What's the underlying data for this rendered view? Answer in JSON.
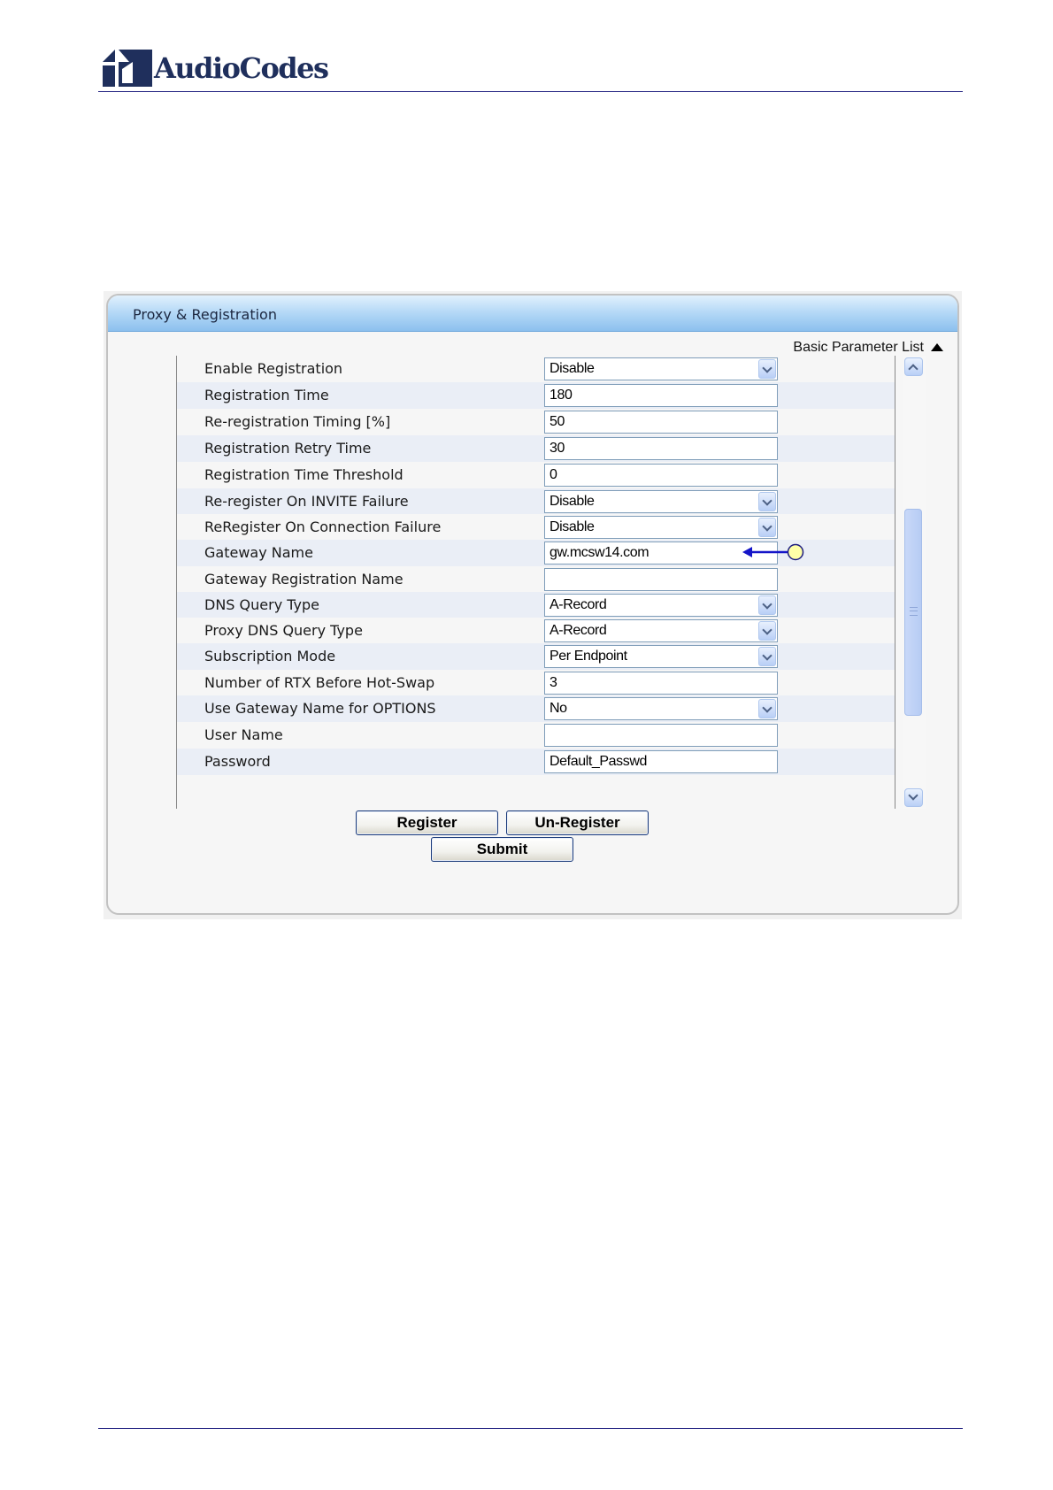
{
  "document": {
    "brand": "AudioCodes"
  },
  "window": {
    "title": "Proxy & Registration"
  },
  "toolbar": {
    "parameter_list_label": "Basic Parameter List"
  },
  "form": {
    "rows": [
      {
        "label": "Enable Registration",
        "type": "select",
        "value": "Disable"
      },
      {
        "label": "Registration Time",
        "type": "input",
        "value": "180"
      },
      {
        "label": "Re-registration Timing [%]",
        "type": "input",
        "value": "50"
      },
      {
        "label": "Registration Retry Time",
        "type": "input",
        "value": "30"
      },
      {
        "label": "Registration Time Threshold",
        "type": "input",
        "value": "0"
      },
      {
        "label": "Re-register On INVITE Failure",
        "type": "select",
        "value": "Disable"
      },
      {
        "label": "ReRegister On Connection Failure",
        "type": "select",
        "value": "Disable"
      },
      {
        "label": "Gateway Name",
        "type": "input",
        "value": "gw.mcsw14.com"
      },
      {
        "label": "Gateway Registration Name",
        "type": "input",
        "value": ""
      },
      {
        "label": "DNS Query Type",
        "type": "select",
        "value": "A-Record"
      },
      {
        "label": "Proxy DNS Query Type",
        "type": "select",
        "value": "A-Record"
      },
      {
        "label": "Subscription Mode",
        "type": "select",
        "value": "Per Endpoint"
      },
      {
        "label": "Number of RTX Before Hot-Swap",
        "type": "input",
        "value": "3"
      },
      {
        "label": "Use Gateway Name for OPTIONS",
        "type": "select",
        "value": "No"
      },
      {
        "label": "User Name",
        "type": "input",
        "value": ""
      },
      {
        "label": "Password",
        "type": "input",
        "value": "Default_Passwd"
      }
    ]
  },
  "buttons": {
    "register": "Register",
    "unregister": "Un-Register",
    "submit": "Submit"
  },
  "colors": {
    "header_gradient_top": "#e1f1fd",
    "header_gradient_bottom": "#8cc0ee",
    "row_alt": "#eaeef6",
    "callout_arrow": "#1414c8",
    "callout_circle": "#ffffa8"
  }
}
